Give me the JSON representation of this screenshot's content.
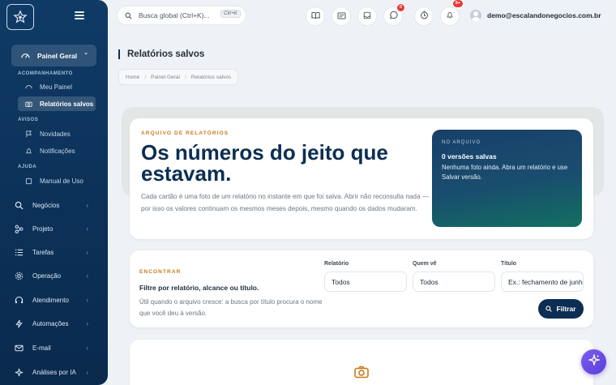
{
  "sidebar": {
    "panel_geral": "Painel Geral",
    "sections": [
      {
        "title": "ACOMPANHAMENTO",
        "items": [
          {
            "label": "Meu Painel"
          },
          {
            "label": "Relatórios salvos",
            "active": true
          }
        ]
      },
      {
        "title": "AVISOS",
        "items": [
          {
            "label": "Novidades"
          },
          {
            "label": "Notificações"
          }
        ]
      },
      {
        "title": "AJUDA",
        "items": [
          {
            "label": "Manual de Uso"
          }
        ]
      }
    ],
    "nav": [
      {
        "label": "Negócios",
        "icon": "search-icon"
      },
      {
        "label": "Projeto",
        "icon": "share-icon"
      },
      {
        "label": "Tarefas",
        "icon": "list-icon"
      },
      {
        "label": "Operação",
        "icon": "gear-icon"
      },
      {
        "label": "Atendimento",
        "icon": "headset-icon"
      },
      {
        "label": "Automações",
        "icon": "bolt-icon"
      },
      {
        "label": "E-mail",
        "icon": "mail-icon"
      },
      {
        "label": "Análises por IA",
        "icon": "sparkle-icon"
      }
    ]
  },
  "topbar": {
    "search_placeholder": "Busca global (Ctrl+K)...",
    "search_shortcut": "Ctrl+K",
    "whatsapp_badge": "0",
    "notifications_badge": "9+",
    "user_email": "demo@escalandonegocios.com.br"
  },
  "page": {
    "title": "Relatórios salvos",
    "breadcrumb": [
      "Home",
      "Painel Geral",
      "Relatórios salvos"
    ]
  },
  "hero": {
    "eyebrow": "ARQUIVO DE RELATÓRIOS",
    "headline": "Os números do jeito que estavam.",
    "description": "Cada cartão é uma foto de um relatório no instante em que foi salva. Abrir não reconsulta nada — por isso os valores continuam os mesmos meses depois, mesmo quando os dados mudaram.",
    "archive_label": "NO ARQUIVO",
    "archive_count": "0 versões salvas",
    "archive_desc": "Nenhuma foto ainda. Abra um relatório e use Salvar versão."
  },
  "filter": {
    "eyebrow": "ENCONTRAR",
    "title": "Filtre por relatório, alcance ou título.",
    "description": "Útil quando o arquivo cresce: a busca por título procura o nome que você deu à versão.",
    "report_label": "Relatório",
    "report_value": "Todos",
    "who_label": "Quem vê",
    "who_value": "Todos",
    "title_label": "Título",
    "title_placeholder": "Ex.: fechamento de junho",
    "button": "Filtrar"
  },
  "colors": {
    "sidebar": "#0c3158",
    "accent": "#c87a1a",
    "primary": "#0c2e52",
    "fab": "#6a4de6"
  }
}
